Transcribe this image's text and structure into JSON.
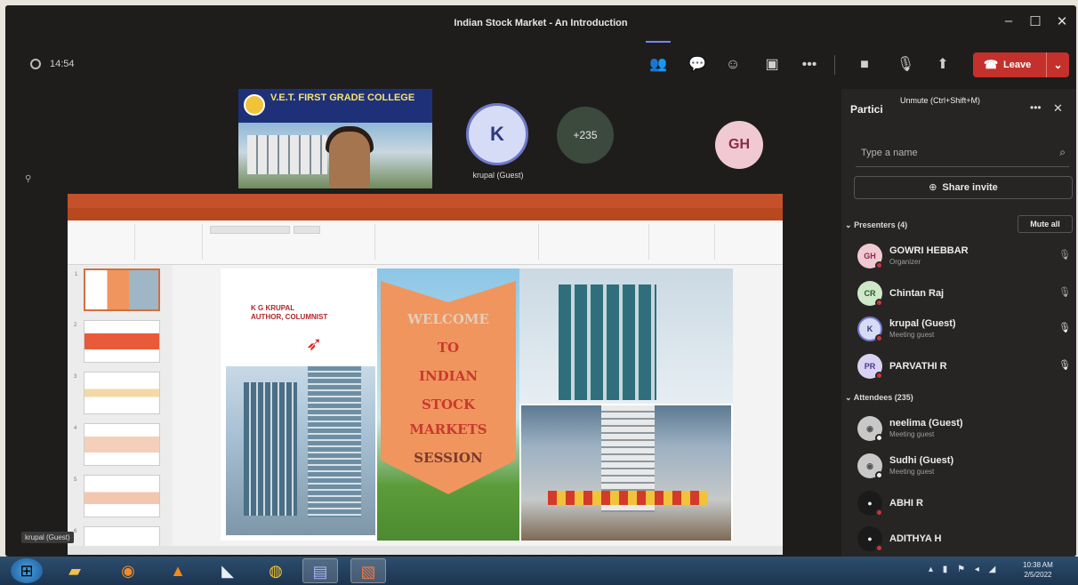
{
  "window": {
    "title": "Indian Stock Market - An Introduction"
  },
  "meeting": {
    "timer": "14:54",
    "leave_label": "Leave",
    "tiles": {
      "college_name": "V.E.T. FIRST GRADE COLLEGE",
      "college_sub": "",
      "k_initial": "K",
      "k_name": "krupal (Guest)",
      "more_count": "+235",
      "gh_initial": "GH"
    },
    "share_name_tag": "krupal (Guest)"
  },
  "slide": {
    "author": "K G KRUPAL",
    "author_sub": "AUTHOR, COLUMNIST",
    "lines": [
      "WELCOME",
      "TO",
      "INDIAN",
      "STOCK",
      "MARKETS",
      "SESSION"
    ]
  },
  "panel": {
    "title": "Partici",
    "tooltip": "Unmute (Ctrl+Shift+M)",
    "search_placeholder": "Type a name",
    "share_invite": "Share invite",
    "presenters_label": "Presenters (4)",
    "mute_all": "Mute all",
    "attendees_label": "Attendees (235)",
    "presenters": [
      {
        "initials": "GH",
        "name": "GOWRI HEBBAR",
        "role": "Organizer",
        "color": "#f1c9d2",
        "text": "#8a2a48"
      },
      {
        "initials": "CR",
        "name": "Chintan Raj",
        "role": "",
        "color": "#cfe8c8",
        "text": "#2c5a24"
      },
      {
        "initials": "K",
        "name": "krupal (Guest)",
        "role": "Meeting guest",
        "color": "#d6dcf5",
        "text": "#2f3a7c"
      },
      {
        "initials": "PR",
        "name": "PARVATHI R",
        "role": "",
        "color": "#d9d2f0",
        "text": "#4a3a8a"
      }
    ],
    "attendees": [
      {
        "initials": "",
        "name": "neelima (Guest)",
        "role": "Meeting guest",
        "color": "#c8c8c8",
        "text": "#555"
      },
      {
        "initials": "",
        "name": "Sudhi (Guest)",
        "role": "Meeting guest",
        "color": "#c8c8c8",
        "text": "#555"
      },
      {
        "initials": "",
        "name": "ABHI R",
        "role": "",
        "color": "#1a1a1a",
        "text": "#eee"
      },
      {
        "initials": "",
        "name": "ADITHYA H",
        "role": "",
        "color": "#1a1a1a",
        "text": "#eee"
      }
    ]
  },
  "taskbar": {
    "time": "10:38 AM",
    "date": "2/5/2022"
  },
  "colors": {
    "teams_accent": "#7b83eb",
    "leave_red": "#c4302b",
    "ppt_orange": "#c4512a"
  }
}
